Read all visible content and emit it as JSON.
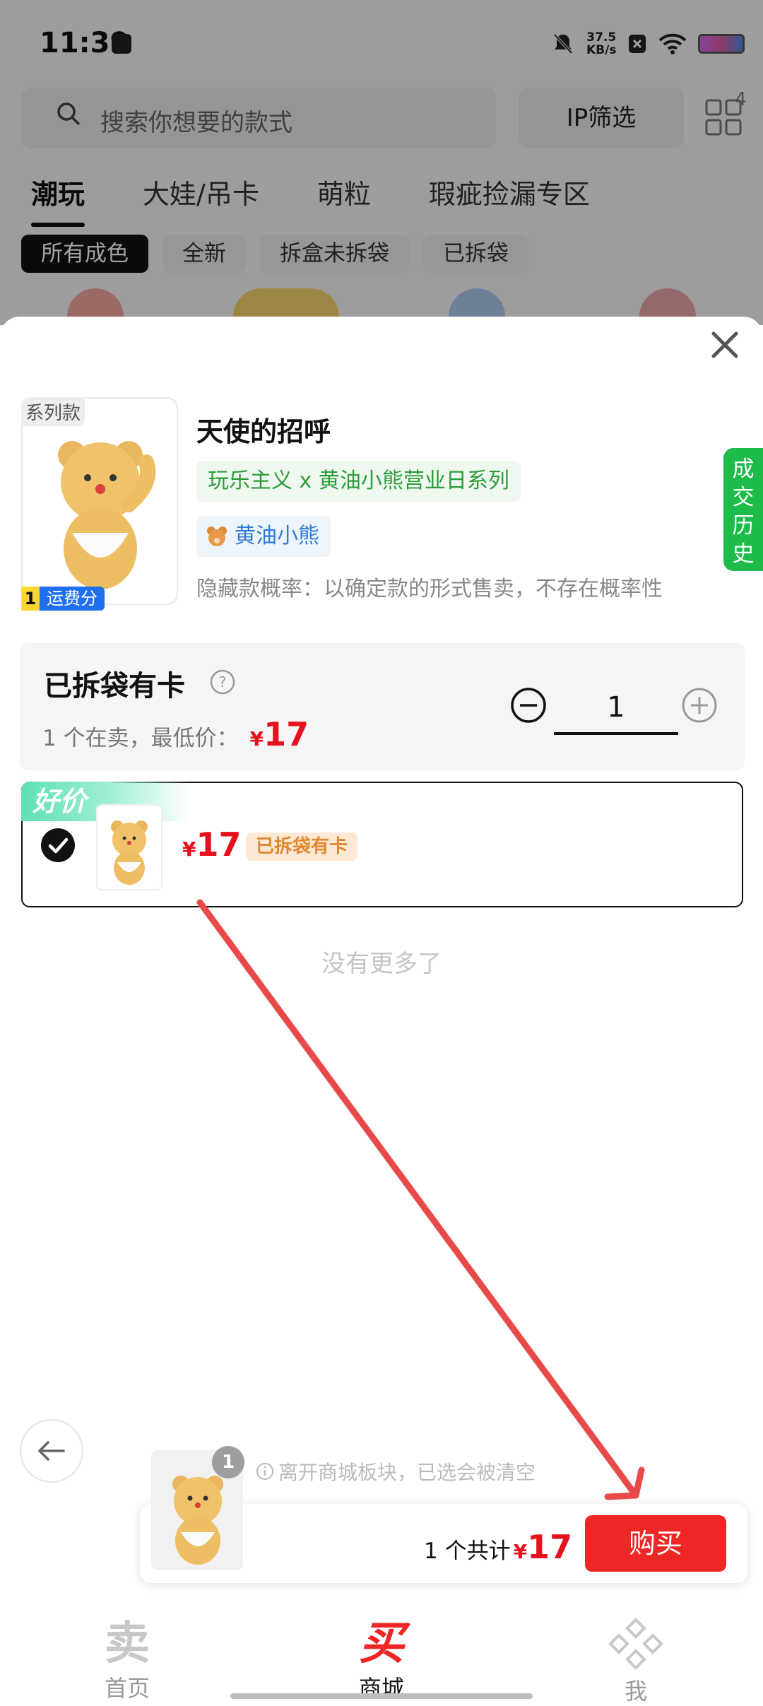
{
  "status_bar": {
    "time": "11:39",
    "net_speed_value": "37.5",
    "net_speed_unit": "KB/s"
  },
  "header": {
    "search_placeholder": "搜索你想要的款式",
    "ip_filter_label": "IP筛选",
    "grid_badge": "4"
  },
  "tabs": [
    {
      "label": "潮玩",
      "active": true
    },
    {
      "label": "大娃/吊卡",
      "active": false
    },
    {
      "label": "萌粒",
      "active": false
    },
    {
      "label": "瑕疵捡漏专区",
      "active": false
    }
  ],
  "condition_chips": [
    {
      "label": "所有成色",
      "active": true
    },
    {
      "label": "全新",
      "active": false
    },
    {
      "label": "拆盒未拆袋",
      "active": false
    },
    {
      "label": "已拆袋",
      "active": false
    }
  ],
  "product": {
    "series_tag": "系列款",
    "freight_num": "1",
    "freight_label": "运费分",
    "name": "天使的招呼",
    "series": "玩乐主义 x 黄油小熊营业日系列",
    "ip_name": "黄油小熊",
    "probability_note": "隐藏款概率：以确定款的形式售卖，不存在概率性"
  },
  "history_tab": {
    "label": [
      "成",
      "交",
      "历",
      "史"
    ]
  },
  "condition": {
    "title": "已拆袋有卡",
    "on_sale_text": "1 个在卖，最低价：",
    "currency": "¥",
    "min_price": "17",
    "quantity": "1"
  },
  "listing": {
    "badge": "好价",
    "currency": "¥",
    "price": "17",
    "tag": "已拆袋有卡"
  },
  "no_more_text": "没有更多了",
  "cart": {
    "hint": "离开商城板块，已选会被清空",
    "badge_count": "1",
    "total_text": "1 个共计",
    "currency": "¥",
    "total": "17",
    "buy_label": "购买"
  },
  "bottom_nav": [
    {
      "glyph": "卖",
      "label": "首页",
      "active": false
    },
    {
      "glyph": "买",
      "label": "商城",
      "active": true
    },
    {
      "glyph": "",
      "label": "我",
      "active": false
    }
  ],
  "colors": {
    "accent_red": "#ef2626",
    "price_red": "#e5121e",
    "history_green": "#1dbb4a",
    "annotation_arrow": "#e84a4a"
  }
}
